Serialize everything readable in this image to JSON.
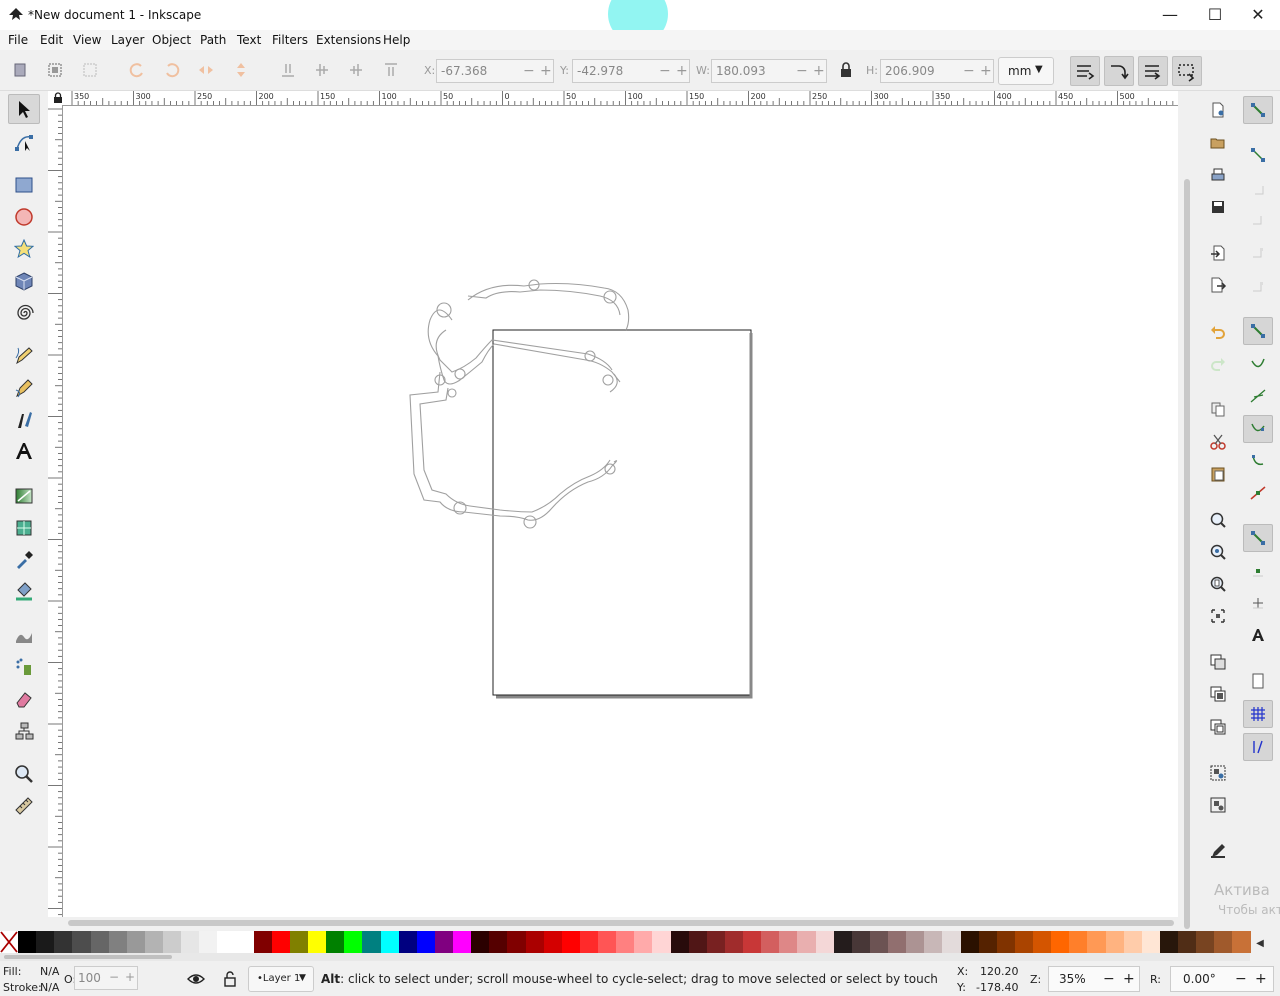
{
  "window": {
    "title": "*New document 1 - Inkscape",
    "minimize": "—",
    "maximize": "☐",
    "close": "✕"
  },
  "menu": [
    "File",
    "Edit",
    "View",
    "Layer",
    "Object",
    "Path",
    "Text",
    "Filters",
    "Extensions",
    "Help"
  ],
  "toolbar": {
    "x_label": "X:",
    "x_value": "-67.368",
    "y_label": "Y:",
    "y_value": "-42.978",
    "w_label": "W:",
    "w_value": "180.093",
    "h_label": "H:",
    "h_value": "206.909",
    "unit": "mm"
  },
  "ruler_labels": [
    "350",
    "300",
    "250",
    "200",
    "150",
    "100",
    "50",
    "0",
    "50",
    "100",
    "150",
    "200",
    "250",
    "300",
    "350",
    "400",
    "450",
    "500"
  ],
  "status": {
    "fill_label": "Fill:",
    "fill_value": "N/A",
    "stroke_label": "Stroke:",
    "stroke_value": "N/A",
    "opacity_label": "O:",
    "opacity_value": "100",
    "layer": "•Layer 1",
    "message_key": "Alt",
    "message": ": click to select under; scroll mouse-wheel to cycle-select; drag to move selected or select by touch",
    "cx_label": "X:",
    "cx_value": "120.20",
    "cy_label": "Y:",
    "cy_value": "-178.40",
    "zoom_label": "Z:",
    "zoom_value": "35%",
    "rot_label": "R:",
    "rot_value": "0.00°"
  },
  "watermark": {
    "line1": "Актива",
    "line2": "Чтобы акт"
  },
  "palette": [
    "#000000",
    "#1a1a1a",
    "#333333",
    "#4d4d4d",
    "#666666",
    "#808080",
    "#999999",
    "#b3b3b3",
    "#cccccc",
    "#e6e6e6",
    "#f2f2f2",
    "#ffffff",
    "#ffffff",
    "#800000",
    "#ff0000",
    "#808000",
    "#ffff00",
    "#008000",
    "#00ff00",
    "#008080",
    "#00ffff",
    "#000080",
    "#0000ff",
    "#800080",
    "#ff00ff",
    "#2b0000",
    "#550000",
    "#800000",
    "#aa0000",
    "#d40000",
    "#ff0000",
    "#ff2a2a",
    "#ff5555",
    "#ff8080",
    "#ffaaaa",
    "#ffd5d5",
    "#280b0b",
    "#501616",
    "#782121",
    "#a02c2c",
    "#c83737",
    "#d35f5f",
    "#de8787",
    "#e9afaf",
    "#f4d7d7",
    "#241c1c",
    "#483737",
    "#6c5353",
    "#916f6f",
    "#ac9393",
    "#c8b7b7",
    "#e3dbdb",
    "#2b1100",
    "#552200",
    "#803300",
    "#aa4400",
    "#d45500",
    "#ff6600",
    "#ff7f2a",
    "#ff9955",
    "#ffb380",
    "#ffccaa",
    "#ffe6d5",
    "#28170b",
    "#502d16",
    "#784421",
    "#a05a2c",
    "#c87137"
  ]
}
